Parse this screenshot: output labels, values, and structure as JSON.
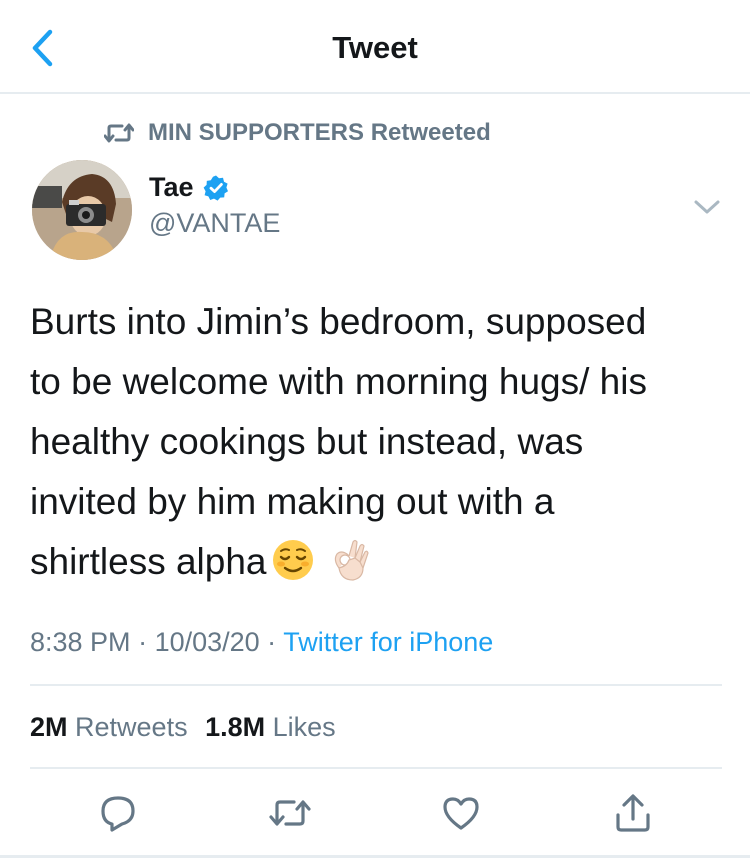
{
  "header": {
    "title": "Tweet"
  },
  "retweet_context": {
    "label": "MIN SUPPORTERS Retweeted"
  },
  "author": {
    "name": "Tae",
    "handle": "@VANTAE",
    "verified": true
  },
  "tweet": {
    "lines": [
      "Burts into Jimin’s bedroom, supposed",
      "to be welcome with morning hugs/ his",
      "healthy cookings but instead, was",
      "invited by him making out with a",
      "shirtless alpha"
    ],
    "emojis": [
      "relieved-face",
      "ok-hand"
    ]
  },
  "meta": {
    "time": "8:38 PM",
    "sep1": " · ",
    "date": "10/03/20",
    "sep2": " · ",
    "source": "Twitter for iPhone"
  },
  "stats": {
    "retweets_count": "2M",
    "retweets_label": "Retweets",
    "likes_count": "1.8M",
    "likes_label": "Likes"
  },
  "colors": {
    "accent": "#1da1f2",
    "secondary_text": "#657786",
    "primary_text": "#14171a",
    "divider": "#e6ecf0"
  },
  "icons": {
    "back": "chevron-left-icon",
    "retweet": "retweet-icon",
    "verified": "verified-badge-icon",
    "caret": "chevron-down-icon",
    "reply": "reply-icon",
    "like": "heart-icon",
    "share": "share-icon"
  }
}
